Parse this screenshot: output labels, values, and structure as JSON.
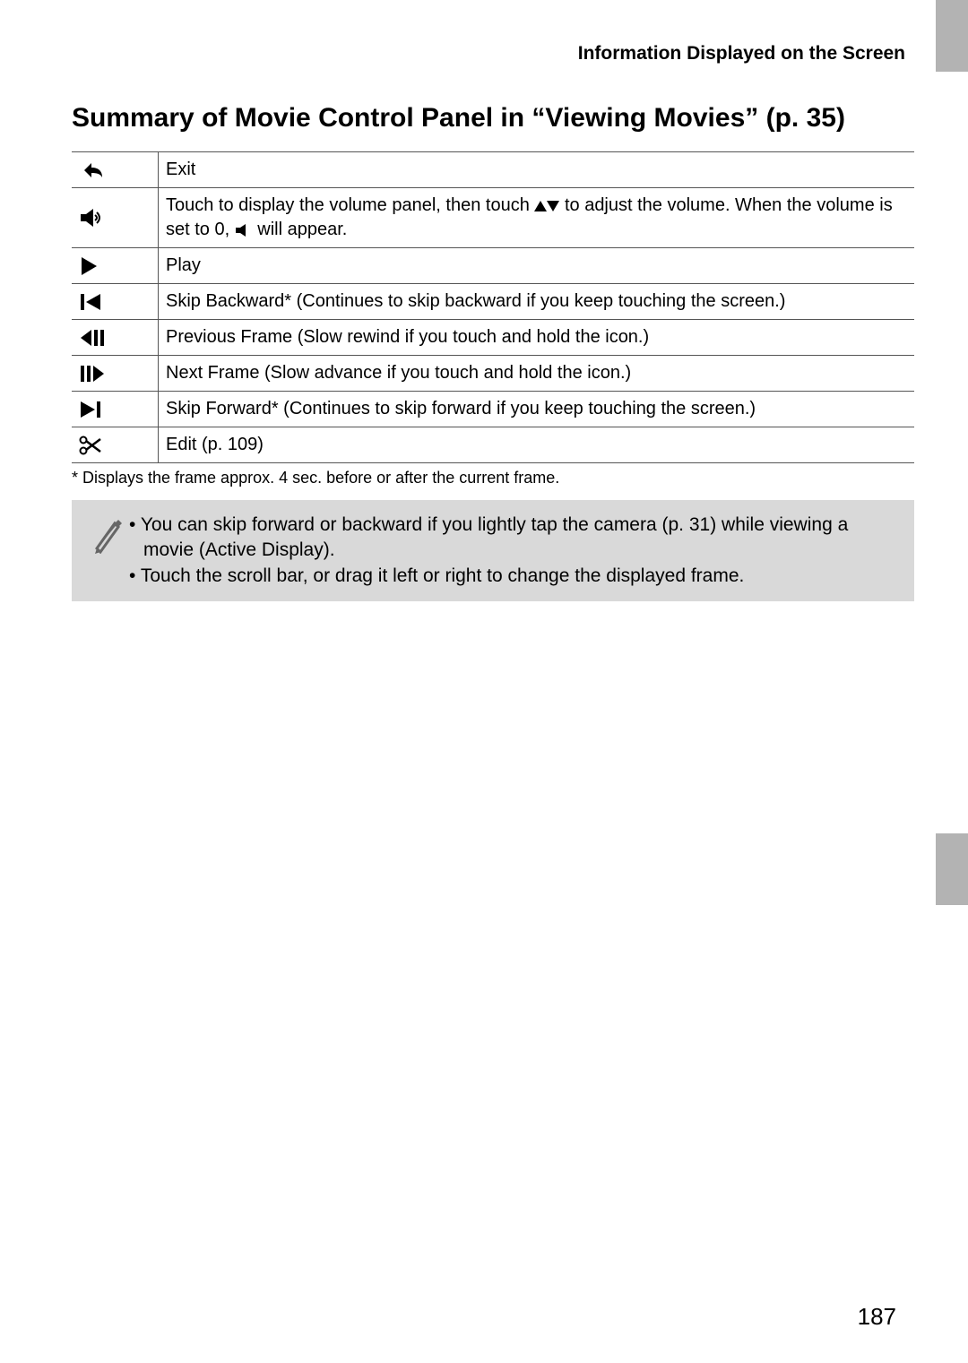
{
  "running_head": "Information Displayed on the Screen",
  "heading": "Summary of Movie Control Panel in “Viewing Movies” (p. 35)",
  "rows": [
    {
      "icon": "return-icon",
      "desc_a": "Exit"
    },
    {
      "icon": "volume-icon",
      "desc_a": "Touch to display the volume panel, then touch ",
      "desc_b": " to adjust the volume. When the volume is set to 0, ",
      "desc_c": " will appear."
    },
    {
      "icon": "play-icon",
      "desc_a": "Play"
    },
    {
      "icon": "skip-back-icon",
      "desc_a": "Skip Backward* (Continues to skip backward if you keep touching the screen.)"
    },
    {
      "icon": "frame-back-icon",
      "desc_a": "Previous Frame (Slow rewind if you touch and hold the icon.)"
    },
    {
      "icon": "frame-fwd-icon",
      "desc_a": "Next Frame (Slow advance if you touch and hold the icon.)"
    },
    {
      "icon": "skip-fwd-icon",
      "desc_a": "Skip Forward* (Continues to skip forward if you keep touching the screen.)"
    },
    {
      "icon": "scissors-icon",
      "desc_a": "Edit (p. 109)"
    }
  ],
  "footnote": "* Displays the frame approx. 4 sec. before or after the current frame.",
  "tips": [
    "You can skip forward or backward if you lightly tap the camera (p. 31) while viewing a movie (Active Display).",
    "Touch the scroll bar, or drag it left or right to change the displayed frame."
  ],
  "bullet": "• ",
  "page_number": "187"
}
